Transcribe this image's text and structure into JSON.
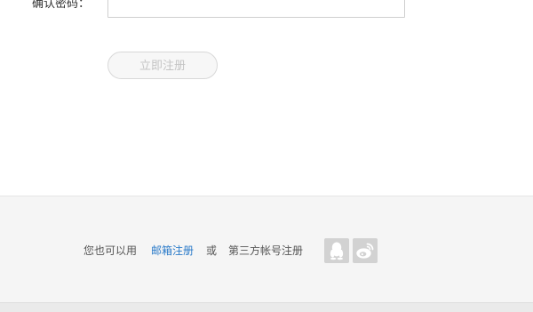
{
  "form": {
    "confirm_password_label": "确认密码：",
    "confirm_password_value": "",
    "register_button_label": "立即注册"
  },
  "footer": {
    "prefix_text": "您也可以用",
    "email_register_link": "邮箱注册",
    "or_text": "或",
    "third_party_text": "第三方帐号注册",
    "social_icons": [
      "qq-icon",
      "weibo-icon"
    ]
  },
  "colors": {
    "link": "#2b7bc9",
    "icon_bg": "#d2d2d2",
    "footer_bg": "#f5f5f5",
    "button_text": "#c4c4c4"
  }
}
